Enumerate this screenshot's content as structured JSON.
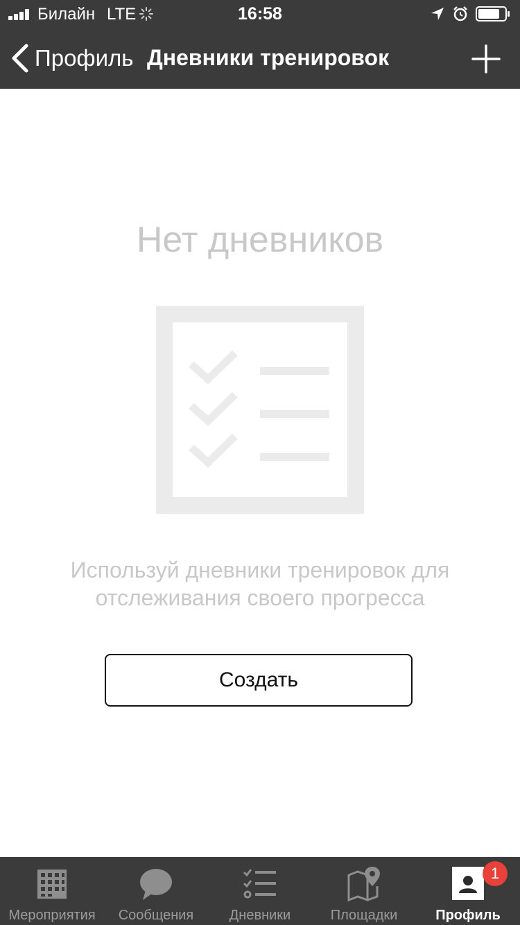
{
  "status_bar": {
    "carrier": "Билайн",
    "network": "LTE",
    "time": "16:58"
  },
  "nav": {
    "back_label": "Профиль",
    "title": "Дневники тренировок"
  },
  "empty_state": {
    "title": "Нет дневников",
    "hint_line1": "Используй дневники тренировок для",
    "hint_line2": "отслеживания своего прогресса",
    "button_label": "Создать"
  },
  "tabs": [
    {
      "label": "Мероприятия",
      "icon": "calendar-grid-icon"
    },
    {
      "label": "Сообщения",
      "icon": "chat-bubble-icon"
    },
    {
      "label": "Дневники",
      "icon": "checklist-icon"
    },
    {
      "label": "Площадки",
      "icon": "map-pin-icon"
    },
    {
      "label": "Профиль",
      "icon": "profile-icon",
      "active": true,
      "badge": "1"
    }
  ],
  "colors": {
    "bar_bg": "#3b3b3b",
    "muted_text": "#c8c8c8",
    "badge": "#e8413a"
  }
}
